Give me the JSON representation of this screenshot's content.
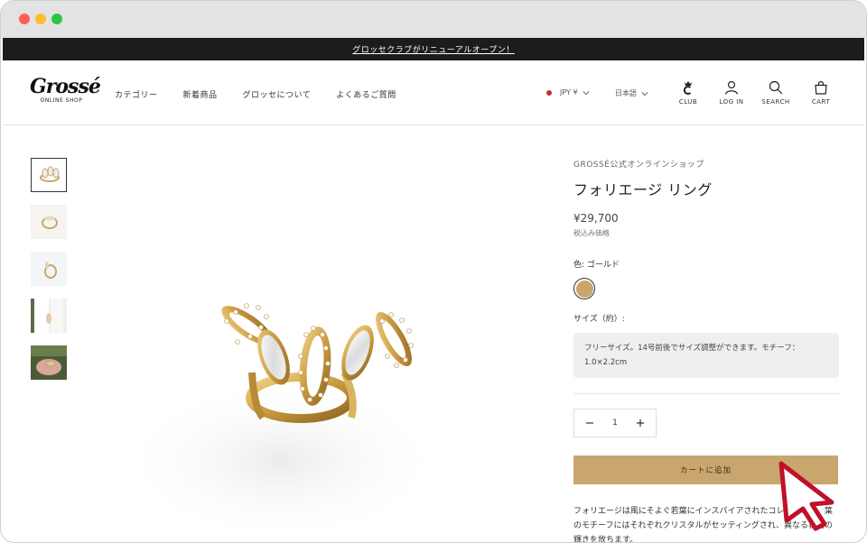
{
  "announcement": {
    "text": "グロッセクラブがリニューアルオープン！"
  },
  "logo": {
    "brand": "Grossé",
    "tagline": "ONLINE SHOP"
  },
  "nav": {
    "items": [
      {
        "label": "カテゴリー"
      },
      {
        "label": "新着商品"
      },
      {
        "label": "グロッセについて"
      },
      {
        "label": "よくあるご質問"
      }
    ]
  },
  "locale": {
    "currency": "JPY ¥",
    "language": "日本語"
  },
  "header_icons": {
    "club": "CLUB",
    "login": "LOG IN",
    "search": "SEARCH",
    "cart": "CART"
  },
  "product": {
    "vendor": "GROSSÉ公式オンラインショップ",
    "title": "フォリエージ リング",
    "price": "¥29,700",
    "tax_note": "税込み価格",
    "color_label": "色: ゴールド",
    "color_swatch": "#c8a66d",
    "size_label": "サイズ（約）:",
    "size_text": "フリーサイズ。14号前後でサイズ調整ができます。モチーフ：1.0×2.2cm",
    "quantity": "1",
    "add_to_cart": "カートに追加",
    "description": "フォリエージは風にそよぐ若葉にインスパイアされたコレクション。葉のモチーフにはそれぞれクリスタルがセッティングされ、異なる表情の輝きを放ちます。"
  },
  "colors": {
    "accent": "#c8a66d",
    "announcement_bg": "#1c1c1c",
    "cursor": "#c0102a"
  }
}
